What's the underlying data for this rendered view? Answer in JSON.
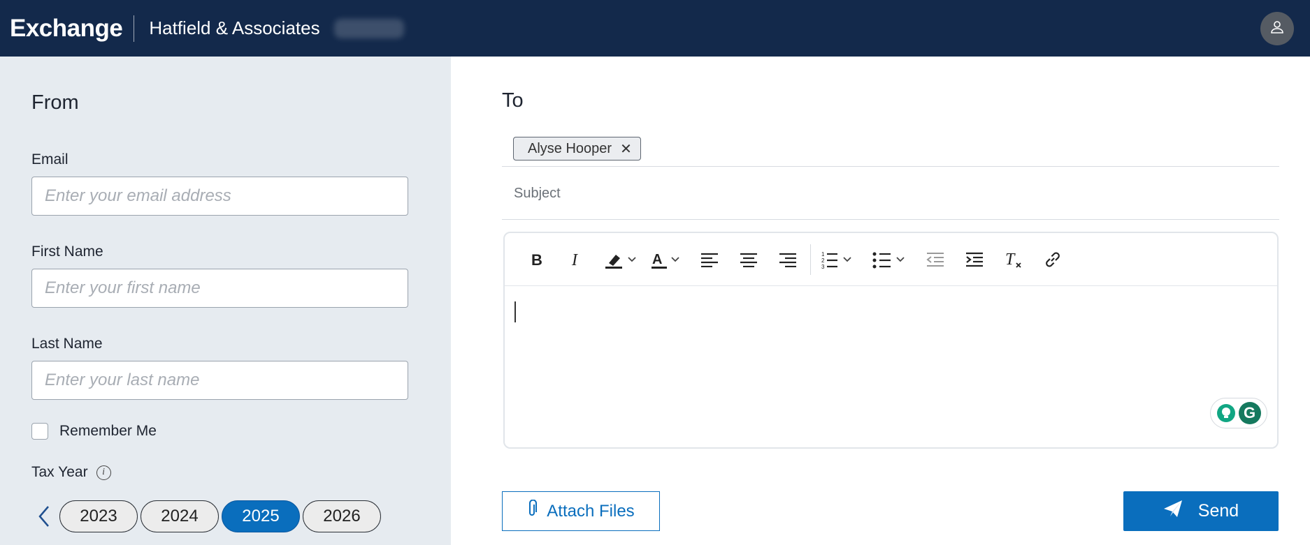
{
  "header": {
    "brand": "Exchange",
    "company": "Hatfield & Associates",
    "avatar_icon": "user-icon"
  },
  "from_panel": {
    "title": "From",
    "email": {
      "label": "Email",
      "placeholder": "Enter your email address",
      "value": ""
    },
    "first_name": {
      "label": "First Name",
      "placeholder": "Enter your first name",
      "value": ""
    },
    "last_name": {
      "label": "Last Name",
      "placeholder": "Enter your last name",
      "value": ""
    },
    "remember_me": {
      "label": "Remember Me",
      "checked": false
    },
    "tax_year": {
      "label": "Tax Year",
      "years": [
        "2023",
        "2024",
        "2025",
        "2026"
      ],
      "selected": "2025"
    }
  },
  "to_panel": {
    "title": "To",
    "recipients": [
      "Alyse Hooper"
    ],
    "subject": {
      "placeholder": "Subject",
      "value": ""
    },
    "toolbar": [
      "bold-icon",
      "italic-icon",
      "highlight-icon",
      "font-color-icon",
      "align-left-icon",
      "align-center-icon",
      "align-right-icon",
      "numbered-list-icon",
      "bulleted-list-icon",
      "outdent-icon",
      "indent-icon",
      "clear-format-icon",
      "link-icon"
    ],
    "body": ""
  },
  "actions": {
    "attach_label": "Attach Files",
    "send_label": "Send"
  },
  "colors": {
    "header_bg": "#13294b",
    "accent": "#0a6ebd",
    "left_panel_bg": "#e6ebf0"
  }
}
